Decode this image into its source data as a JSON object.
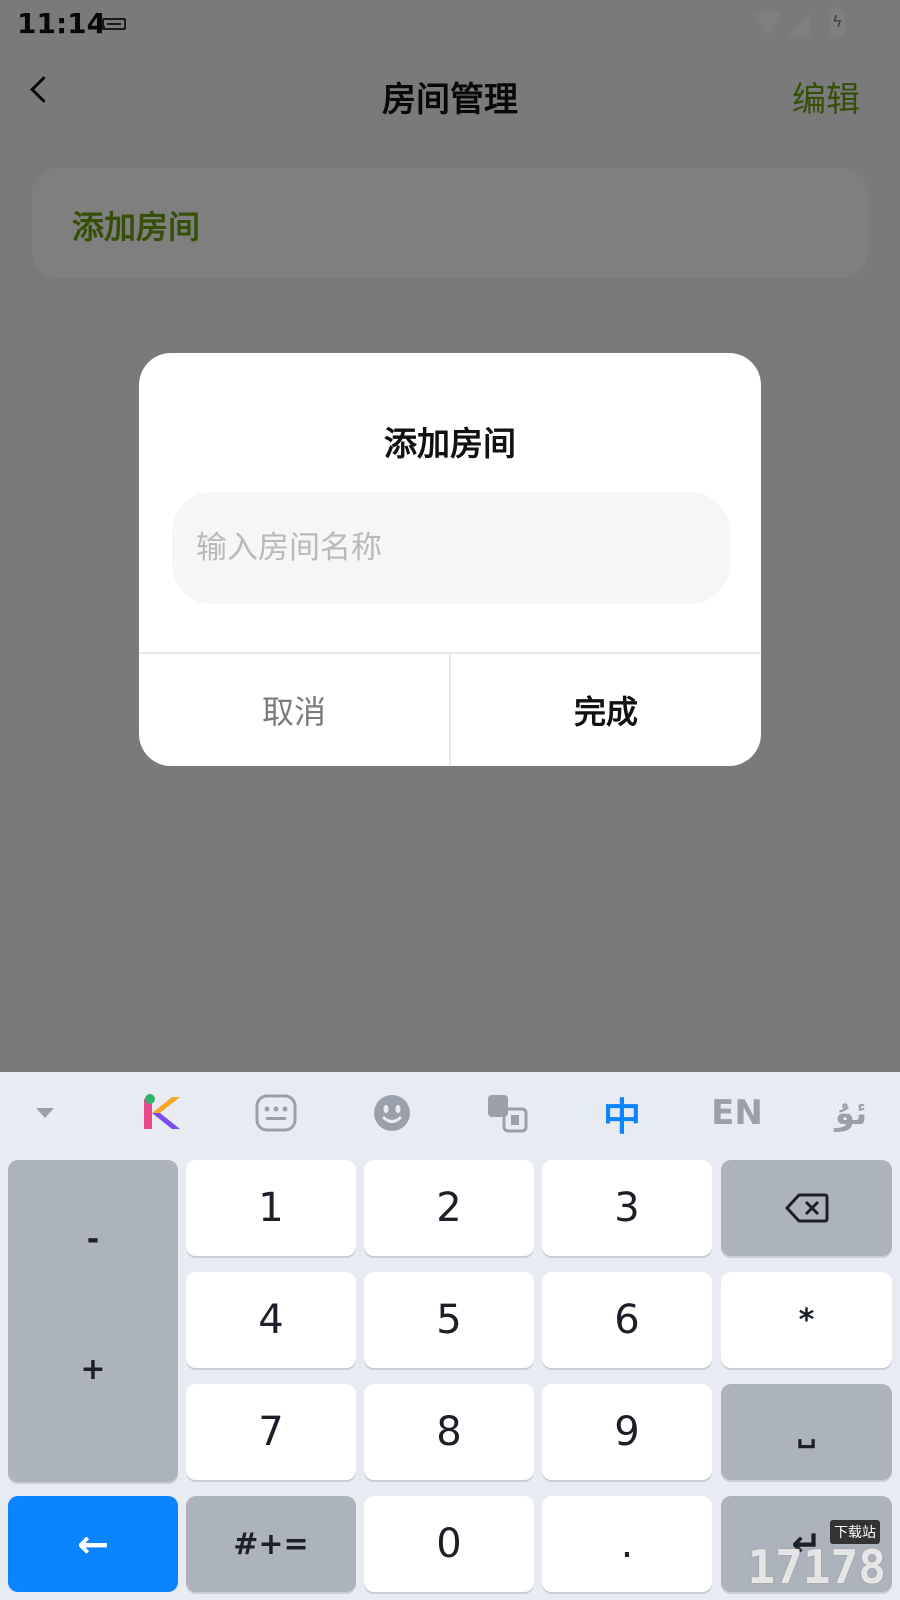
{
  "status_bar": {
    "time": "11:14"
  },
  "navbar": {
    "title": "房间管理",
    "edit_label": "编辑"
  },
  "add_card": {
    "label": "添加房间"
  },
  "dialog": {
    "title": "添加房间",
    "input_placeholder": "输入房间名称",
    "input_value": "",
    "cancel_label": "取消",
    "done_label": "完成"
  },
  "keyboard": {
    "toolbar": {
      "language_zh": "中",
      "language_en": "EN",
      "language_ug": "ئۇ"
    },
    "keys": {
      "minus": "-",
      "plus": "+",
      "k1": "1",
      "k2": "2",
      "k3": "3",
      "k4": "4",
      "k5": "5",
      "k6": "6",
      "k7": "7",
      "k8": "8",
      "k9": "9",
      "k0": "0",
      "star": "*",
      "space": "␣",
      "back": "←",
      "symbols": "#+=",
      "dot": ".",
      "enter": "↵",
      "delete": "⌫"
    }
  },
  "watermark": {
    "text": "17178",
    "sub": "下载站"
  },
  "colors": {
    "accent_green": "#6a9e13",
    "keyboard_blue": "#0a84ff"
  }
}
